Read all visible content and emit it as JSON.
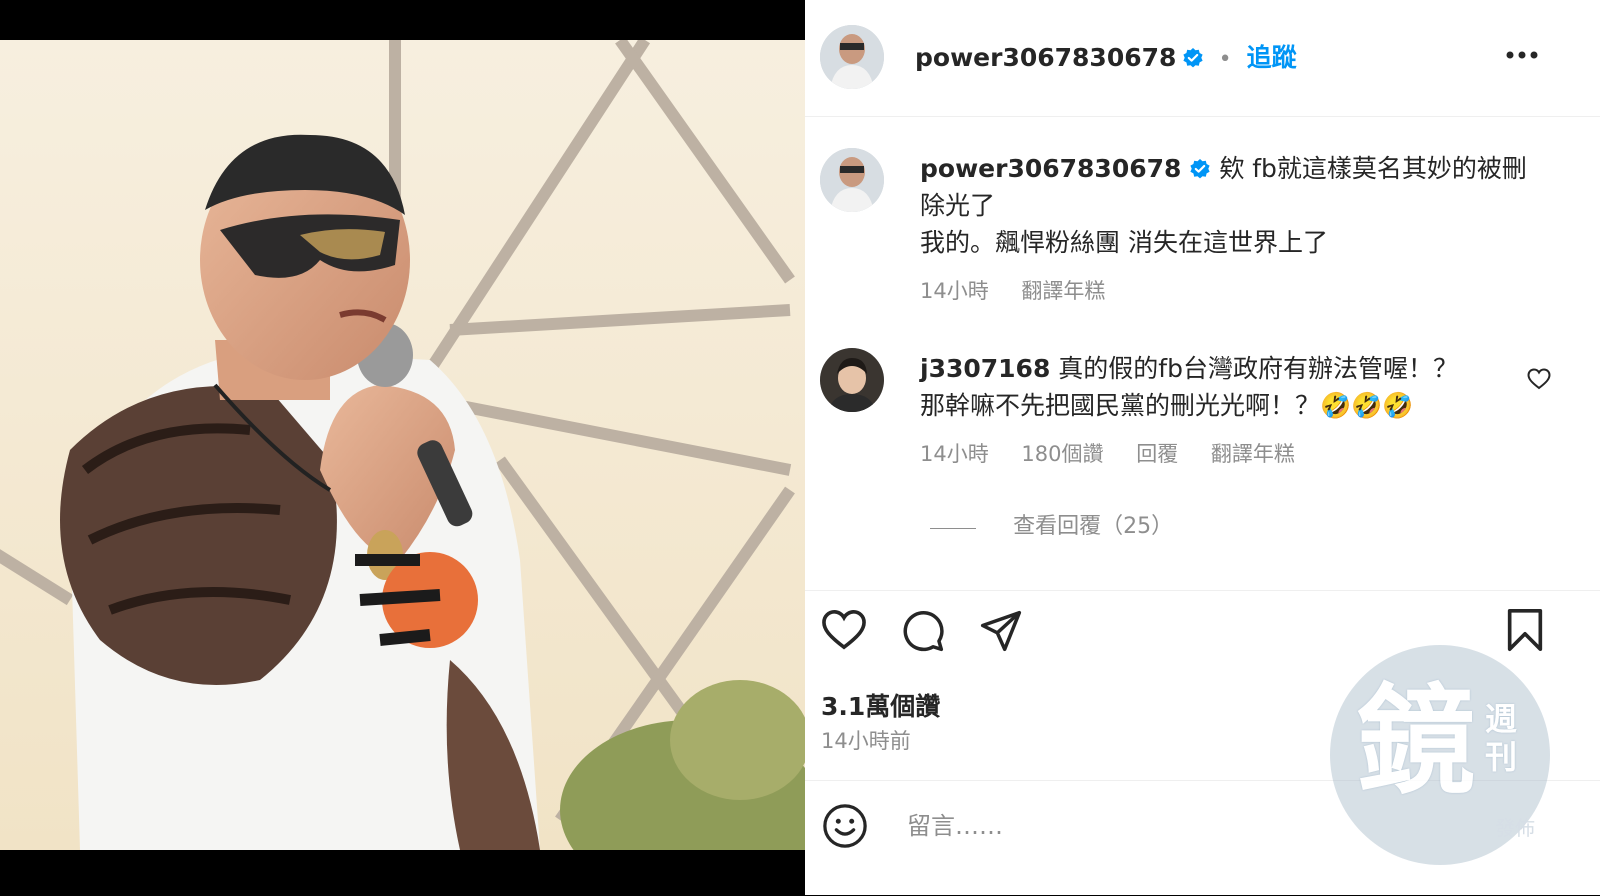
{
  "post": {
    "author": "power3067830678",
    "separator": "•",
    "follow_label": "追蹤",
    "more_icon": "more-horizontal-icon"
  },
  "caption": {
    "author": "power3067830678",
    "line1": "欸 fb就這樣莫名其妙的被刪",
    "line2": "除光了",
    "line3": "我的。飆悍粉絲團 消失在這世界上了",
    "time": "14小時",
    "translate": "翻譯年糕"
  },
  "reply": {
    "author": "j3307168",
    "line1": "真的假的fb台灣政府有辦法管喔！？",
    "line2": "那幹嘛不先把國民黨的刪光光啊！？🤣🤣🤣",
    "time": "14小時",
    "likes": "180個讚",
    "reply_label": "回覆",
    "translate": "翻譯年糕",
    "view_replies": "查看回覆（25）"
  },
  "actions": {
    "likes": "3.1萬個讚",
    "time": "14小時前"
  },
  "comment_box": {
    "placeholder": "留言……"
  },
  "watermark": {
    "main": "鏡",
    "sub": "週刊",
    "foot": "發佈"
  },
  "colors": {
    "link": "#0095f6",
    "verified": "#0095f6",
    "muted": "#8e8e8e"
  }
}
